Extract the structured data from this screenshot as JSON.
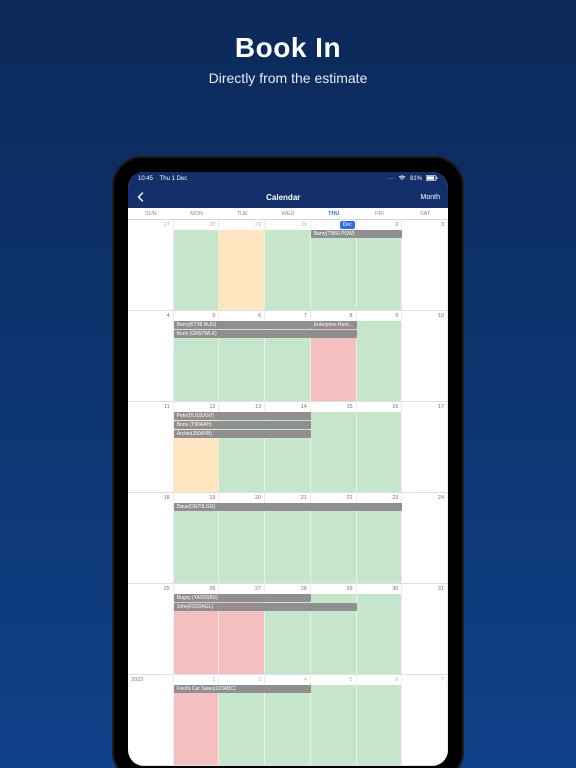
{
  "hero": {
    "title": "Book In",
    "subtitle": "Directly from the estimate"
  },
  "statusbar": {
    "time": "10:45",
    "date": "Thu 1 Dec",
    "battery_pct": "81%",
    "wifi_name": "wifi-icon",
    "batt_name": "battery-icon"
  },
  "navbar": {
    "back_icon": "‹",
    "title": "Calendar",
    "right": "Month"
  },
  "weekdays": [
    "SUN",
    "MON",
    "TUE",
    "WED",
    "THU",
    "FRI",
    "SAT"
  ],
  "today_weekday_index": 4,
  "today_label": "Dec",
  "col_pct": 14.2857,
  "weeks": [
    {
      "days": [
        {
          "date": "27",
          "outside": true,
          "bg": "none"
        },
        {
          "date": "28",
          "outside": true,
          "bg": "green"
        },
        {
          "date": "29",
          "outside": true,
          "bg": "peach"
        },
        {
          "date": "30",
          "outside": true,
          "bg": "green"
        },
        {
          "date": "1",
          "today": true,
          "bg": "green"
        },
        {
          "date": "2",
          "bg": "green"
        },
        {
          "date": "3",
          "bg": "none"
        }
      ],
      "events": [
        {
          "label": "Barry(TN50 POW)",
          "start": 4,
          "span": 2,
          "row": 0
        }
      ]
    },
    {
      "days": [
        {
          "date": "4",
          "bg": "none"
        },
        {
          "date": "5",
          "bg": "green"
        },
        {
          "date": "6",
          "bg": "green"
        },
        {
          "date": "7",
          "bg": "green"
        },
        {
          "date": "8",
          "bg": "red"
        },
        {
          "date": "9",
          "bg": "green"
        },
        {
          "date": "10",
          "bg": "none"
        }
      ],
      "events": [
        {
          "label": "Barry(KT08 NUU)",
          "start": 1,
          "span": 3,
          "row": 0
        },
        {
          "label": "Enterprise Rent...",
          "start": 4,
          "span": 1,
          "row": 0
        },
        {
          "label": "Boris (GN57WLK)",
          "start": 1,
          "span": 4,
          "row": 1
        }
      ]
    },
    {
      "days": [
        {
          "date": "11",
          "bg": "none"
        },
        {
          "date": "12",
          "bg": "peach"
        },
        {
          "date": "13",
          "bg": "green"
        },
        {
          "date": "14",
          "bg": "green"
        },
        {
          "date": "15",
          "bg": "green"
        },
        {
          "date": "16",
          "bg": "green"
        },
        {
          "date": "17",
          "bg": "none"
        }
      ],
      "events": [
        {
          "label": "Pete(DU10UGV)",
          "start": 1,
          "span": 3,
          "row": 0
        },
        {
          "label": "Boris (T90AAH)",
          "start": 1,
          "span": 3,
          "row": 1
        },
        {
          "label": "Archie(J90AYB)",
          "start": 1,
          "span": 3,
          "row": 2
        }
      ]
    },
    {
      "days": [
        {
          "date": "18",
          "bg": "none"
        },
        {
          "date": "19",
          "bg": "green"
        },
        {
          "date": "20",
          "bg": "green"
        },
        {
          "date": "21",
          "bg": "green"
        },
        {
          "date": "22",
          "bg": "green"
        },
        {
          "date": "23",
          "bg": "green"
        },
        {
          "date": "24",
          "bg": "none"
        }
      ],
      "events": [
        {
          "label": "Dave(GN70LGG)",
          "start": 1,
          "span": 5,
          "row": 0
        }
      ]
    },
    {
      "days": [
        {
          "date": "25",
          "bg": "none"
        },
        {
          "date": "26",
          "bg": "red"
        },
        {
          "date": "27",
          "bg": "red"
        },
        {
          "date": "28",
          "bg": "green"
        },
        {
          "date": "29",
          "bg": "green"
        },
        {
          "date": "30",
          "bg": "green"
        },
        {
          "date": "31",
          "bg": "none"
        }
      ],
      "events": [
        {
          "label": "Bugsy (YA02GBX)",
          "start": 1,
          "span": 3,
          "row": 0
        },
        {
          "label": "John(FD22AGL)",
          "start": 1,
          "span": 4,
          "row": 1
        }
      ]
    },
    {
      "year_label": "2023",
      "days": [
        {
          "date": "",
          "outside": true,
          "bg": "none"
        },
        {
          "date": "2",
          "outside": true,
          "bg": "red"
        },
        {
          "date": "3",
          "outside": true,
          "bg": "green"
        },
        {
          "date": "4",
          "outside": true,
          "bg": "green"
        },
        {
          "date": "5",
          "outside": true,
          "bg": "green"
        },
        {
          "date": "6",
          "outside": true,
          "bg": "green"
        },
        {
          "date": "7",
          "outside": true,
          "bg": "none"
        }
      ],
      "events": [
        {
          "label": "Fred's Car Sales(123ABC)",
          "start": 1,
          "span": 3,
          "row": 0
        }
      ]
    }
  ]
}
